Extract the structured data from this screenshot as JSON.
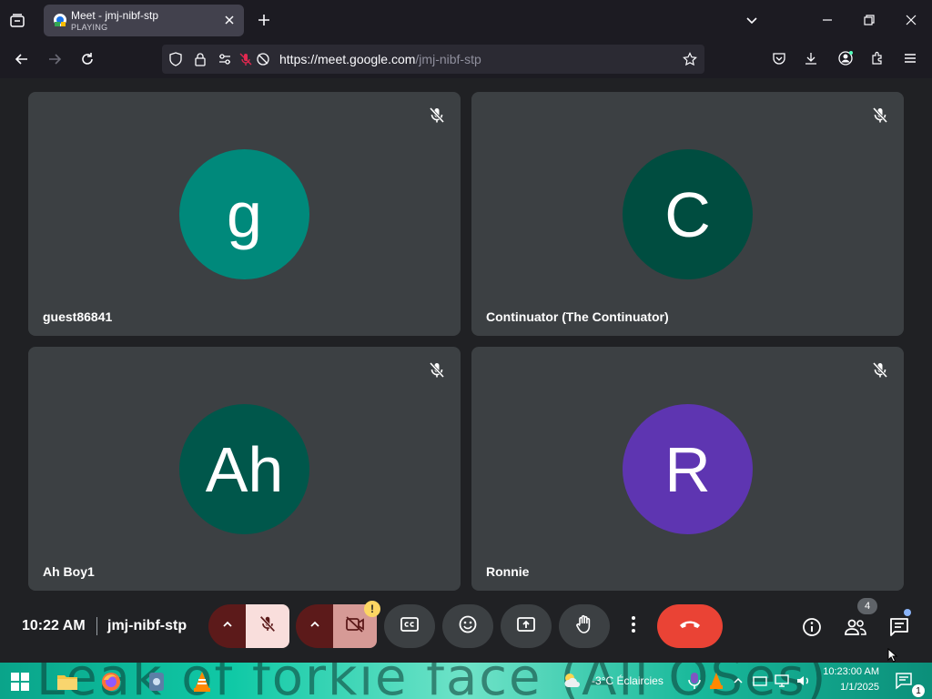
{
  "browser": {
    "tab_title": "Meet - jmj-nibf-stp",
    "tab_status": "PLAYING",
    "url_host": "https://meet.google.com",
    "url_path": "/jmj-nibf-stp"
  },
  "participants": [
    {
      "name": "guest86841",
      "initial": "g",
      "color": "#00897b"
    },
    {
      "name": "Continuator (The Continuator)",
      "initial": "C",
      "color": "#004d40"
    },
    {
      "name": "Ah Boy1",
      "initial": "Ah",
      "color": "#00574b"
    },
    {
      "name": "Ronnie",
      "initial": "R",
      "color": "#5e35b1"
    }
  ],
  "meeting": {
    "time": "10:22 AM",
    "code": "jmj-nibf-stp",
    "people_count": "4",
    "camera_warning": "!"
  },
  "taskbar": {
    "banner_text": "Leak of forkie face (All OSes)",
    "weather": "-3°C Éclaircies",
    "time": "10:23:00 AM",
    "date": "1/1/2025",
    "notification_count": "1"
  },
  "colors": {
    "tile_bg": "#3c4043",
    "end_call": "#ea4335",
    "mic_off_bg": "#f9dedc",
    "page_bg": "#202124"
  }
}
